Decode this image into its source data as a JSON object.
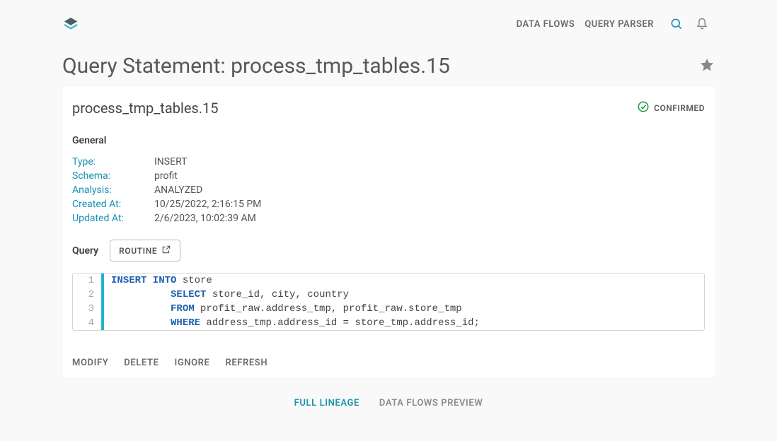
{
  "nav": {
    "data_flows": "DATA FLOWS",
    "query_parser": "QUERY PARSER"
  },
  "title": "Query Statement: process_tmp_tables.15",
  "subtitle": "process_tmp_tables.15",
  "status": "CONFIRMED",
  "general": {
    "heading": "General",
    "labels": {
      "type": "Type:",
      "schema": "Schema:",
      "analysis": "Analysis:",
      "created": "Created At:",
      "updated": "Updated At:"
    },
    "values": {
      "type": "INSERT",
      "schema": "profit",
      "analysis": "ANALYZED",
      "created": "10/25/2022, 2:16:15 PM",
      "updated": "2/6/2023, 10:02:39 AM"
    }
  },
  "query": {
    "heading": "Query",
    "routine_button": "ROUTINE",
    "lines": [
      {
        "n": "1",
        "indent": "",
        "kw": "INSERT INTO",
        "rest": " store"
      },
      {
        "n": "2",
        "indent": "          ",
        "kw": "SELECT",
        "rest": " store_id, city, country"
      },
      {
        "n": "3",
        "indent": "          ",
        "kw": "FROM",
        "rest": " profit_raw.address_tmp, profit_raw.store_tmp"
      },
      {
        "n": "4",
        "indent": "          ",
        "kw": "WHERE",
        "rest": " address_tmp.address_id = store_tmp.address_id;"
      }
    ]
  },
  "actions": {
    "modify": "MODIFY",
    "delete": "DELETE",
    "ignore": "IGNORE",
    "refresh": "REFRESH"
  },
  "tabs": {
    "full_lineage": "FULL LINEAGE",
    "data_flows_preview": "DATA FLOWS PREVIEW"
  }
}
